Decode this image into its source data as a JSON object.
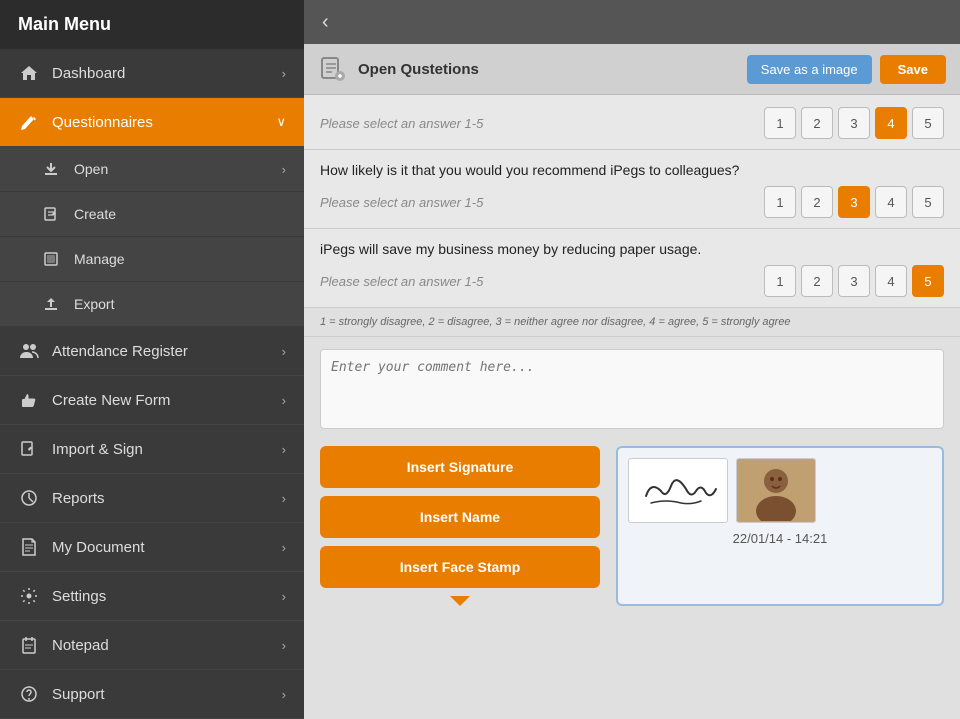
{
  "sidebar": {
    "header": "Main Menu",
    "items": [
      {
        "id": "dashboard",
        "label": "Dashboard",
        "icon": "🏠",
        "hasChevron": true,
        "active": false
      },
      {
        "id": "questionnaires",
        "label": "Questionnaires",
        "icon": "✏️",
        "hasChevron": true,
        "active": true,
        "subItems": [
          {
            "id": "open",
            "label": "Open",
            "icon": "⬇",
            "hasChevron": true
          },
          {
            "id": "create",
            "label": "Create",
            "icon": "✎",
            "hasChevron": false
          },
          {
            "id": "manage",
            "label": "Manage",
            "icon": "⊡",
            "hasChevron": false
          },
          {
            "id": "export",
            "label": "Export",
            "icon": "↗",
            "hasChevron": false
          }
        ]
      },
      {
        "id": "attendance",
        "label": "Attendance Register",
        "icon": "👥",
        "hasChevron": true,
        "active": false
      },
      {
        "id": "create-new-form",
        "label": "Create New Form",
        "icon": "👍",
        "hasChevron": true,
        "active": false
      },
      {
        "id": "import-sign",
        "label": "Import & Sign",
        "icon": "✎",
        "hasChevron": true,
        "active": false
      },
      {
        "id": "reports",
        "label": "Reports",
        "icon": "◕",
        "hasChevron": true,
        "active": false
      },
      {
        "id": "my-document",
        "label": "My Document",
        "icon": "🗎",
        "hasChevron": true,
        "active": false
      },
      {
        "id": "settings",
        "label": "Settings",
        "icon": "⚙",
        "hasChevron": true,
        "active": false
      },
      {
        "id": "notepad",
        "label": "Notepad",
        "icon": "📋",
        "hasChevron": true,
        "active": false
      },
      {
        "id": "support",
        "label": "Support",
        "icon": "💬",
        "hasChevron": true,
        "active": false
      }
    ]
  },
  "formHeader": {
    "icon": "📋",
    "title": "Open Qustetions",
    "saveImageLabel": "Save as a image",
    "saveLabel": "Save"
  },
  "questions": [
    {
      "id": "q1",
      "text": "",
      "placeholder": "Please select an answer 1-5",
      "ratings": [
        1,
        2,
        3,
        4,
        5
      ],
      "selected": 4
    },
    {
      "id": "q2",
      "text": "How likely is it that you would you recommend iPegs to colleagues?",
      "placeholder": "Please select an answer 1-5",
      "ratings": [
        1,
        2,
        3,
        4,
        5
      ],
      "selected": 3
    },
    {
      "id": "q3",
      "text": "iPegs will save my business money by reducing paper usage.",
      "placeholder": "Please select an answer 1-5",
      "ratings": [
        1,
        2,
        3,
        4,
        5
      ],
      "selected": 5
    }
  ],
  "scaleNote": "1 = strongly disagree,  2 = disagree,  3 = neither agree nor disagree, 4 = agree,  5 = strongly agree",
  "commentPlaceholder": "Enter your comment here...",
  "actionButtons": {
    "insertSignature": "Insert Signature",
    "insertName": "Insert Name",
    "insertFaceStamp": "Insert Face Stamp"
  },
  "signaturePreview": {
    "timestamp": "22/01/14 - 14:21"
  },
  "colors": {
    "orange": "#e87d00",
    "blue": "#5b9bd5",
    "activeSidebar": "#e87d00"
  }
}
